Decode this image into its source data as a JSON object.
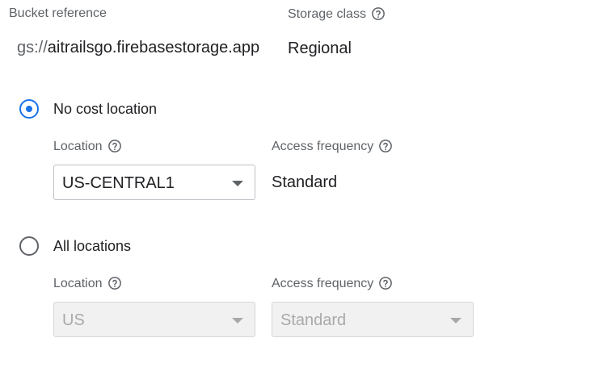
{
  "bucket": {
    "reference_label": "Bucket reference",
    "reference_prefix": "gs://",
    "reference_value": "aitrailsgo.firebasestorage.app",
    "storage_class_label": "Storage class",
    "storage_class_value": "Regional"
  },
  "no_cost": {
    "option_label": "No cost location",
    "selected": true,
    "location_label": "Location",
    "location_value": "US-CENTRAL1",
    "access_frequency_label": "Access frequency",
    "access_frequency_value": "Standard"
  },
  "all_locations": {
    "option_label": "All locations",
    "selected": false,
    "location_label": "Location",
    "location_value": "US",
    "access_frequency_label": "Access frequency",
    "access_frequency_value": "Standard"
  },
  "colors": {
    "accent": "#1a73e8",
    "muted_text": "#5f6368",
    "disabled_fill": "#f1f1f1"
  }
}
